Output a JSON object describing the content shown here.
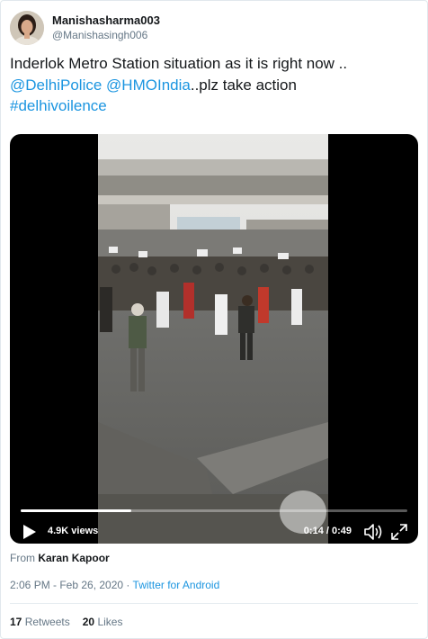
{
  "author": {
    "display_name": "Manishasharma003",
    "handle": "@Manishasingh006"
  },
  "tweet": {
    "text_start": "Inderlok Metro Station situation as it is right now ..",
    "mention_1": "@DelhiPolice",
    "mention_2": "@HMOIndia",
    "text_end": "..plz take action",
    "hashtag": "#delhivoilence"
  },
  "video": {
    "views": "4.9K views",
    "time": "0:14 / 0:49",
    "progress_fraction": 0.286,
    "icons": [
      "play-icon",
      "volume-icon",
      "fullscreen-icon"
    ]
  },
  "source": {
    "prefix": "From",
    "name": "Karan Kapoor"
  },
  "meta": {
    "datetime": "2:06 PM - Feb 26, 2020",
    "separator": "·",
    "client": "Twitter for Android"
  },
  "stats": {
    "retweets_count": "17",
    "retweets_label": "Retweets",
    "likes_count": "20",
    "likes_label": "Likes"
  },
  "colors": {
    "link": "#1b95e0",
    "muted": "#657786",
    "text": "#14171a"
  }
}
